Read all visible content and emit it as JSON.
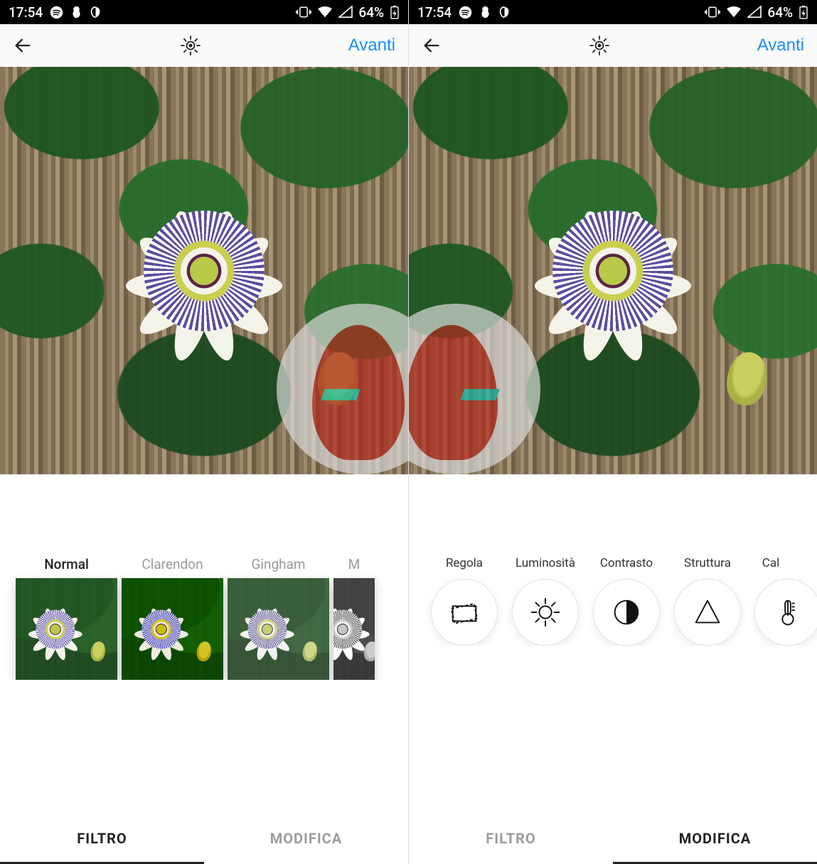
{
  "status": {
    "time": "17:54",
    "battery": "64%"
  },
  "toolbar": {
    "next": "Avanti"
  },
  "filters": {
    "items": [
      {
        "label": "Normal"
      },
      {
        "label": "Clarendon"
      },
      {
        "label": "Gingham"
      },
      {
        "label": "M"
      }
    ]
  },
  "edit": {
    "items": [
      {
        "label": "Regola"
      },
      {
        "label": "Luminosità"
      },
      {
        "label": "Contrasto"
      },
      {
        "label": "Struttura"
      },
      {
        "label": "Cal"
      }
    ]
  },
  "tabs": {
    "filtro": "FILTRO",
    "modifica": "MODIFICA"
  }
}
